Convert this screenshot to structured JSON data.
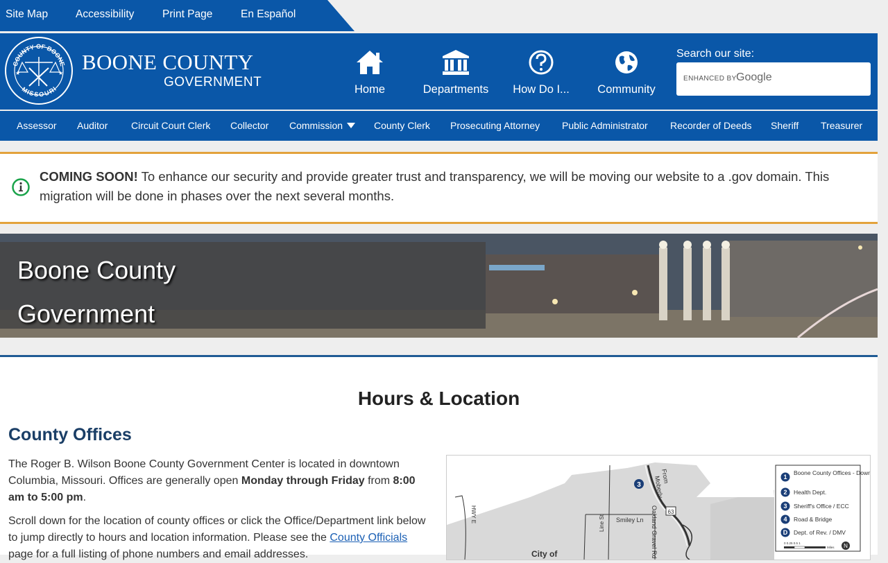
{
  "utility_nav": [
    "Site Map",
    "Accessibility",
    "Print Page",
    "En Español"
  ],
  "brand": {
    "line1": "BOONE COUNTY",
    "line2": "GOVERNMENT",
    "seal_top": "COUNTY OF BOONE",
    "seal_bottom": "MISSOURI"
  },
  "quick_nav": [
    {
      "label": "Home",
      "icon": "home-icon"
    },
    {
      "label": "Departments",
      "icon": "building-columns-icon"
    },
    {
      "label": "How Do I...",
      "icon": "question-circle-icon"
    },
    {
      "label": "Community",
      "icon": "globe-icon"
    }
  ],
  "search": {
    "label": "Search our site:",
    "enhanced_by": "ENHANCED BY",
    "provider": "Google"
  },
  "department_nav": [
    "Assessor",
    "Auditor",
    "Circuit Court Clerk",
    "Collector",
    "Commission",
    "County Clerk",
    "Prosecuting Attorney",
    "Public Administrator",
    "Recorder of Deeds",
    "Sheriff",
    "Treasurer"
  ],
  "alert": {
    "strong": "COMING SOON!",
    "text": " To enhance our security and provide greater trust and transparency, we will be moving our website to a .gov domain. This migration will be done in phases over the next several months."
  },
  "hero": {
    "line1": "Boone County",
    "line2": "Government"
  },
  "main": {
    "heading": "Hours & Location",
    "subheading": "County Offices",
    "para1": {
      "t1": "The Roger B. Wilson Boone County Government Center is located in downtown Columbia, Missouri. Offices are generally open ",
      "b1": "Monday through Friday",
      "t2": " from ",
      "b2": "8:00 am to 5:00 pm",
      "t3": "."
    },
    "para2": {
      "t1": "Scroll down for the location of county offices or click the Office/Department link below to jump directly to hours and location information. Please see the ",
      "link": "County Officials",
      "t2": " page for a full listing of phone numbers and email addresses."
    }
  },
  "map": {
    "legend": [
      {
        "num": "1",
        "text": "Boone County Offices - Downtown"
      },
      {
        "num": "2",
        "text": "Health Dept."
      },
      {
        "num": "3",
        "text": "Sheriff's Office / ECC"
      },
      {
        "num": "4",
        "text": "Road & Bridge"
      },
      {
        "num": "D",
        "text": "Dept. of Rev. / DMV"
      }
    ],
    "labels": {
      "from": "From",
      "moberly": "Moberly",
      "smiley": "Smiley Ln",
      "oakland": "Oakland Gravel Rd",
      "hwye": "HWY E",
      "line_st": "Line St",
      "city": "City of",
      "hwy63": "63",
      "marker3": "3",
      "miles": "Miles",
      "scale": "0   0.25  0.5         1"
    }
  }
}
